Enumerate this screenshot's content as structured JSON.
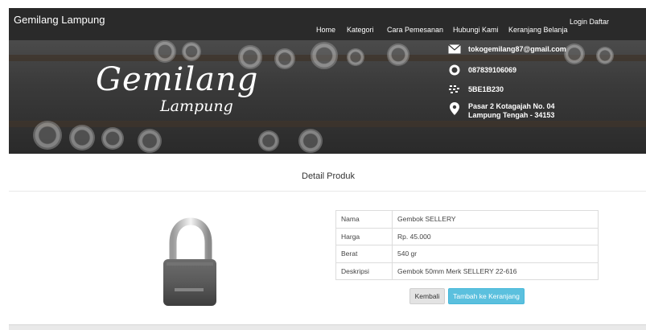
{
  "navbar": {
    "brand": "Gemilang Lampung",
    "items": [
      {
        "label": "Home"
      },
      {
        "label": "Kategori"
      },
      {
        "label": "Cara Pemesanan"
      },
      {
        "label": "Hubungi Kami"
      },
      {
        "label": "Keranjang Belanja"
      }
    ],
    "login": "Login Daftar"
  },
  "banner": {
    "title": "Gemilang",
    "subtitle": "Lampung",
    "contacts": {
      "email": "tokogemilang87@gmail.com",
      "whatsapp": "087839106069",
      "bbm": "5BE1B230",
      "address_line1": "Pasar 2 Kotagajah No. 04",
      "address_line2": "Lampung Tengah - 34153"
    }
  },
  "page": {
    "section_title": "Detail Produk"
  },
  "product": {
    "rows": [
      {
        "key": "Nama",
        "value": "Gembok SELLERY"
      },
      {
        "key": "Harga",
        "value": "Rp. 45.000"
      },
      {
        "key": "Berat",
        "value": "540 gr"
      },
      {
        "key": "Deskripsi",
        "value": "Gembok 50mm Merk SELLERY 22-616"
      }
    ],
    "back_label": "Kembali",
    "add_label": "Tambah ke Keranjang"
  },
  "colors": {
    "navbar_bg": "#2a2a2a",
    "primary_button": "#5bc0de"
  }
}
